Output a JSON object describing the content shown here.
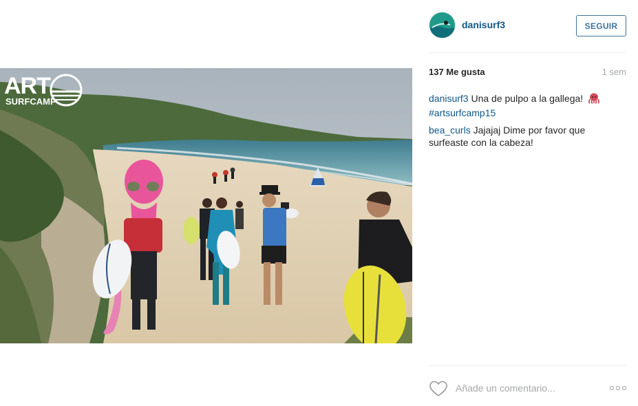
{
  "post": {
    "image_alt": "Surfistas en la playa con disfraz de pulpo",
    "watermark": {
      "brand": "ART",
      "sub": "SURFCAMP"
    }
  },
  "header": {
    "username": "danisurf3",
    "follow_label": "SEGUIR"
  },
  "stats": {
    "likes": "137 Me gusta",
    "time_ago": "1 sem"
  },
  "comments": [
    {
      "user": "danisurf3",
      "text": "Una de pulpo a la gallega!",
      "hashtag": "#artsurfcamp15",
      "emoji": "octopus-emoji"
    },
    {
      "user": "bea_curls",
      "text": "Jajajaj Dime por favor que surfeaste con la cabeza!"
    }
  ],
  "footer": {
    "comment_placeholder": "Añade un comentario...",
    "like_icon": "heart-icon",
    "more_icon": "more-options-icon"
  },
  "colors": {
    "link": "#125688",
    "follow_border": "#3f729b",
    "muted": "#a5a7aa"
  }
}
